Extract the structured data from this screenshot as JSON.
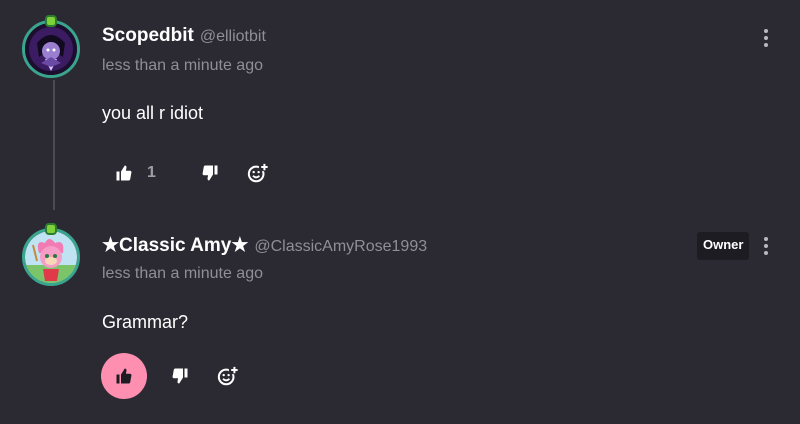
{
  "colors": {
    "background": "#2b2a33",
    "secondary_text": "#8f8e99",
    "avatar_ring": "#3aa58f",
    "like_active": "#ff8fb1",
    "owner_badge_bg": "#1d1c23"
  },
  "comments": [
    {
      "display_name": "Scopedbit",
      "handle": "@elliotbit",
      "timestamp": "less than a minute ago",
      "body": "you all r idiot",
      "like_count": "1",
      "liked": false,
      "is_owner": false,
      "avatar_icon": "avatar-dark-purple-character",
      "icons": [
        "thumbs-up-icon",
        "thumbs-down-icon",
        "add-reaction-icon",
        "more-vertical-icon"
      ]
    },
    {
      "display_name": "★Classic Amy★",
      "handle": "@ClassicAmyRose1993",
      "timestamp": "less than a minute ago",
      "body": "Grammar?",
      "badge": "Owner",
      "liked": true,
      "is_owner": true,
      "avatar_icon": "avatar-pink-hedgehog-character",
      "icons": [
        "thumbs-up-icon",
        "thumbs-down-icon",
        "add-reaction-icon",
        "more-vertical-icon"
      ]
    }
  ]
}
